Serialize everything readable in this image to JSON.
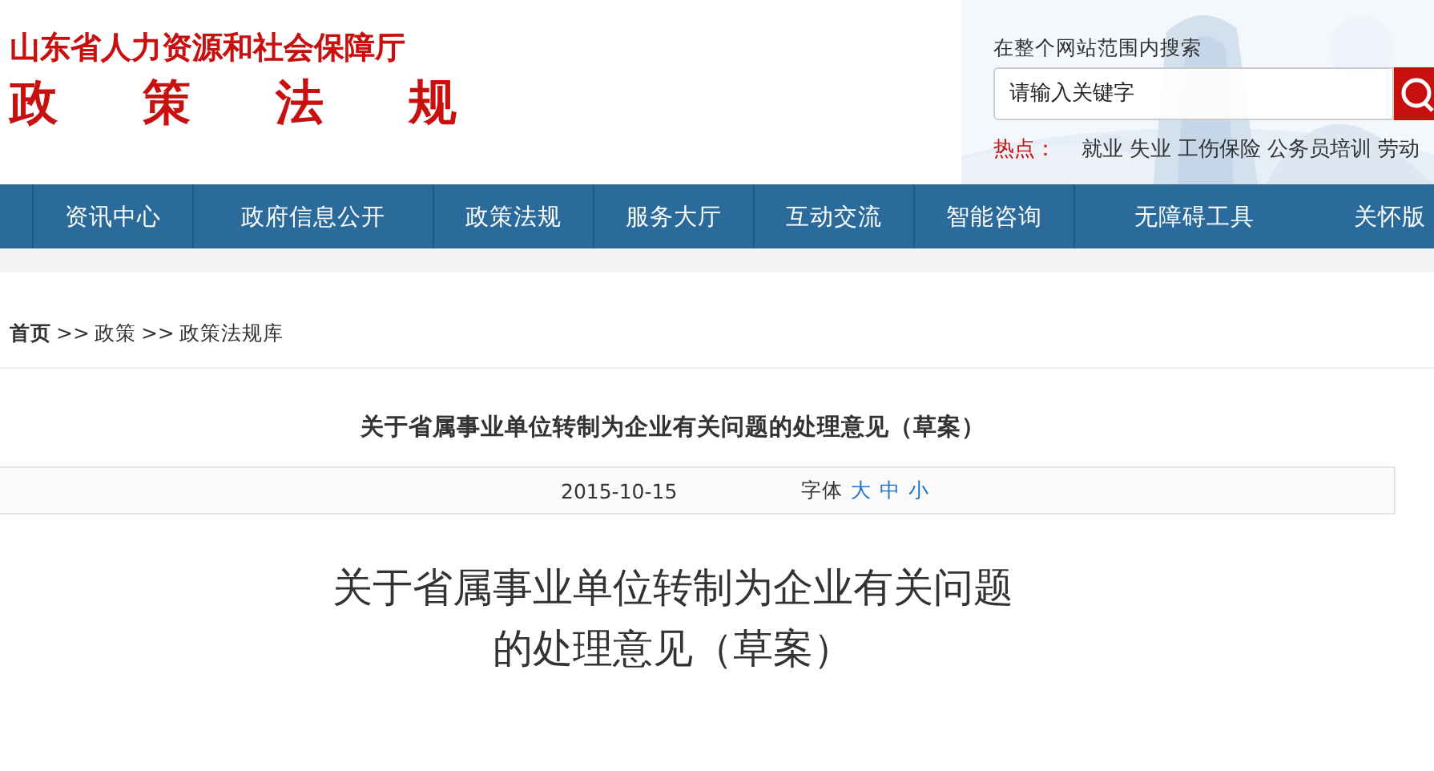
{
  "header": {
    "org": "山东省人力资源和社会保障厅",
    "section": [
      "政",
      "策",
      "法",
      "规"
    ],
    "search_label": "在整个网站范围内搜索",
    "search": {
      "placeholder": "请输入关键字"
    },
    "hot_label": "热点：",
    "hot_links": [
      "就业",
      "失业",
      "工伤保险",
      "公务员培训",
      "劳动"
    ]
  },
  "nav": [
    "资讯中心",
    "政府信息公开",
    "政策法规",
    "服务大厅",
    "互动交流",
    "智能咨询",
    "无障碍工具",
    "关怀版"
  ],
  "breadcrumb": [
    {
      "kind": "home",
      "label": "首页"
    },
    {
      "kind": "sep",
      "label": ">>"
    },
    {
      "kind": "link",
      "label": "政策"
    },
    {
      "kind": "sep",
      "label": ">>"
    },
    {
      "kind": "link",
      "label": "政策法规库"
    }
  ],
  "article": {
    "heading": "关于省属事业单位转制为企业有关问题的处理意见（草案）",
    "date": "2015-10-15",
    "font_label": "字体",
    "font_sizes": [
      "大",
      "中",
      "小"
    ],
    "title_lines": [
      "关于省属事业单位转制为企业有关问题",
      "的处理意见（草案）"
    ]
  }
}
